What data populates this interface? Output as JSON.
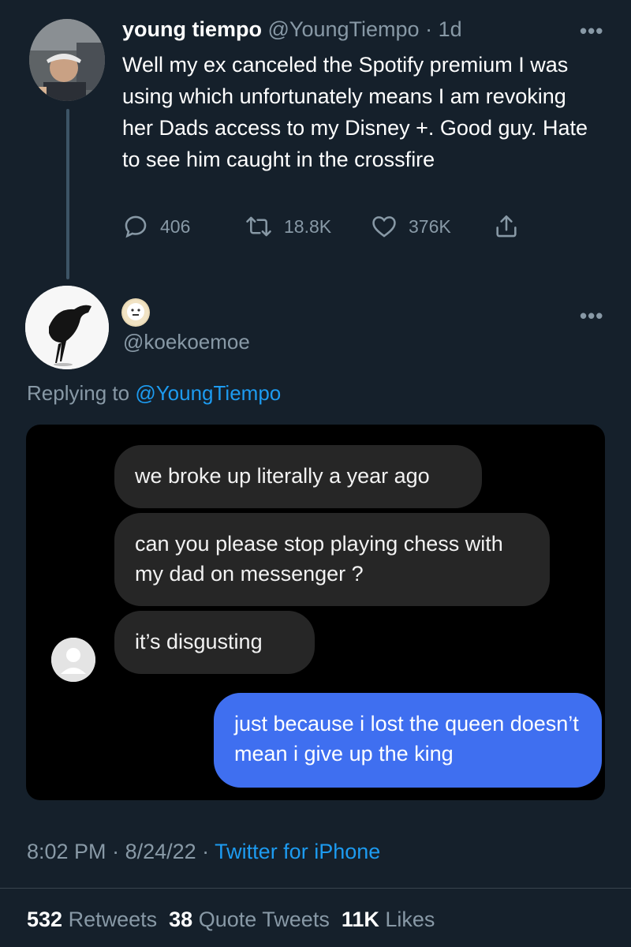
{
  "tweet": {
    "author_name": "young tiempo",
    "author_handle": "@YoungTiempo",
    "time_ago": "1d",
    "text": "Well my ex canceled the Spotify premium I was using which unfortunately means I am revoking her Dads access to my Disney +. Good guy. Hate to see him caught in the crossfire",
    "replies": "406",
    "retweets": "18.8K",
    "likes": "376K",
    "more_icon": "more-icon"
  },
  "reply": {
    "handle": "@koekoemoe",
    "replying_prefix": "Replying to",
    "replying_handle": "@YoungTiempo",
    "screenshot": {
      "messages": [
        {
          "side": "received",
          "text": "we broke up literally a year ago"
        },
        {
          "side": "received",
          "text": "can you please stop playing chess with my dad on messenger ?"
        },
        {
          "side": "received",
          "text": "it’s disgusting"
        },
        {
          "side": "sent",
          "text": "just because i lost the queen doesn’t mean i give up the king"
        }
      ]
    },
    "time": "8:02 PM",
    "date": "8/24/22",
    "source": "Twitter for iPhone",
    "retweets_count": "532",
    "retweets_label": "Retweets",
    "quotes_count": "38",
    "quotes_label": "Quote Tweets",
    "likes_count": "11K",
    "likes_label": "Likes"
  },
  "colors": {
    "background": "#15202b",
    "muted": "#8899a6",
    "link": "#1d9bf0",
    "sent_bubble": "#3f6ff0",
    "received_bubble": "#262626"
  }
}
